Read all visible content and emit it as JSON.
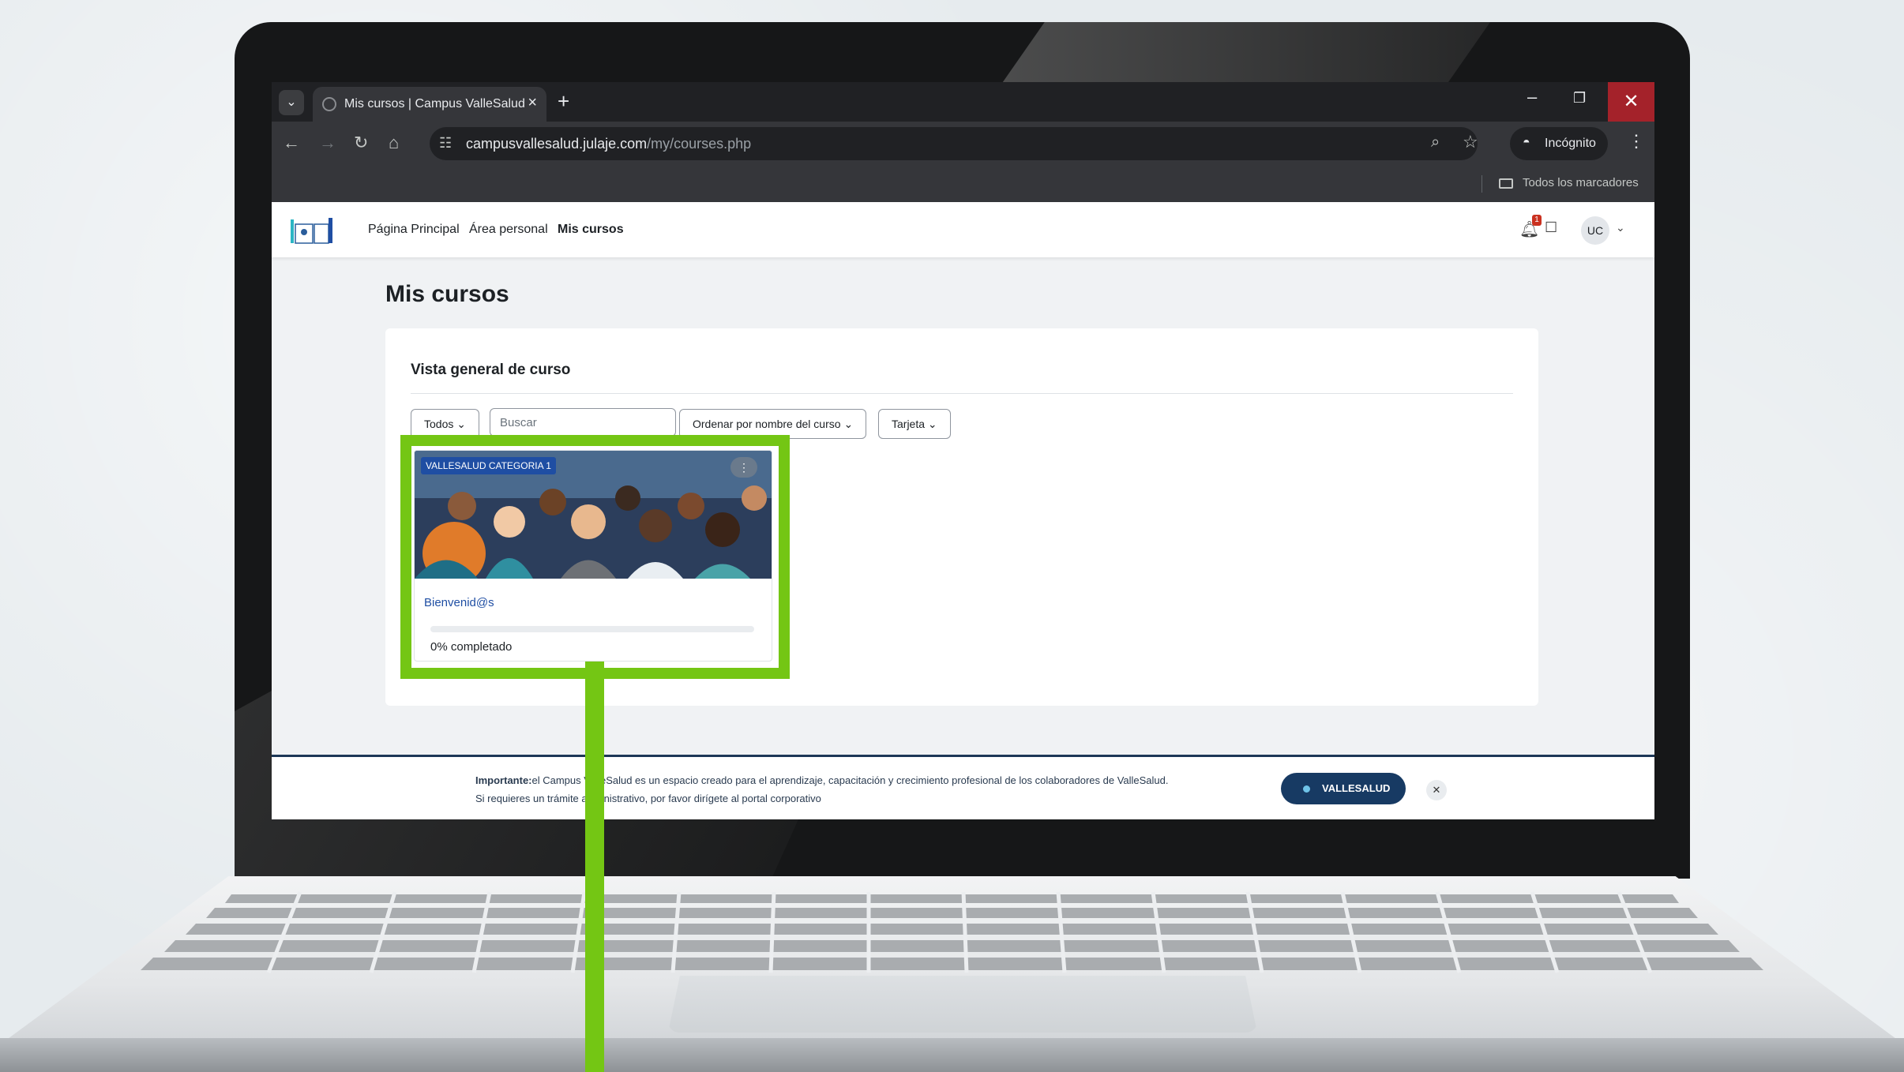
{
  "browser": {
    "tab_title": "Mis cursos | Campus ValleSalud",
    "url_host": "campusvallesalud.julaje.com",
    "url_path": "/my/courses.php",
    "incognito_label": "Incógnito",
    "bookmarks_label": "Todos los marcadores"
  },
  "site": {
    "nav": [
      "Página Principal",
      "Área personal",
      "Mis cursos"
    ],
    "active_nav": "Mis cursos",
    "notification_count": "1",
    "user_initials": "UC"
  },
  "page": {
    "title": "Mis cursos",
    "panel_title": "Vista general de curso",
    "filters": {
      "grouping": "Todos",
      "search_placeholder": "Buscar",
      "sort": "Ordenar por nombre del curso",
      "view": "Tarjeta"
    }
  },
  "course": {
    "category": "VALLESALUD CATEGORIA 1",
    "name": "Bienvenid@s",
    "progress": 0,
    "progress_label": "0% completado"
  },
  "notice": {
    "strong": "Importante:",
    "line1": "el Campus ValleSalud es un espacio creado para el aprendizaje, capacitación y crecimiento profesional de los colaboradores de ValleSalud.",
    "line2": "Si requieres un trámite administrativo, por favor dirígete al portal corporativo",
    "button_label": "VALLESALUD"
  },
  "colors": {
    "highlight": "#74c614",
    "brand_blue": "#1f4ea3",
    "notice_button": "#173a63"
  }
}
